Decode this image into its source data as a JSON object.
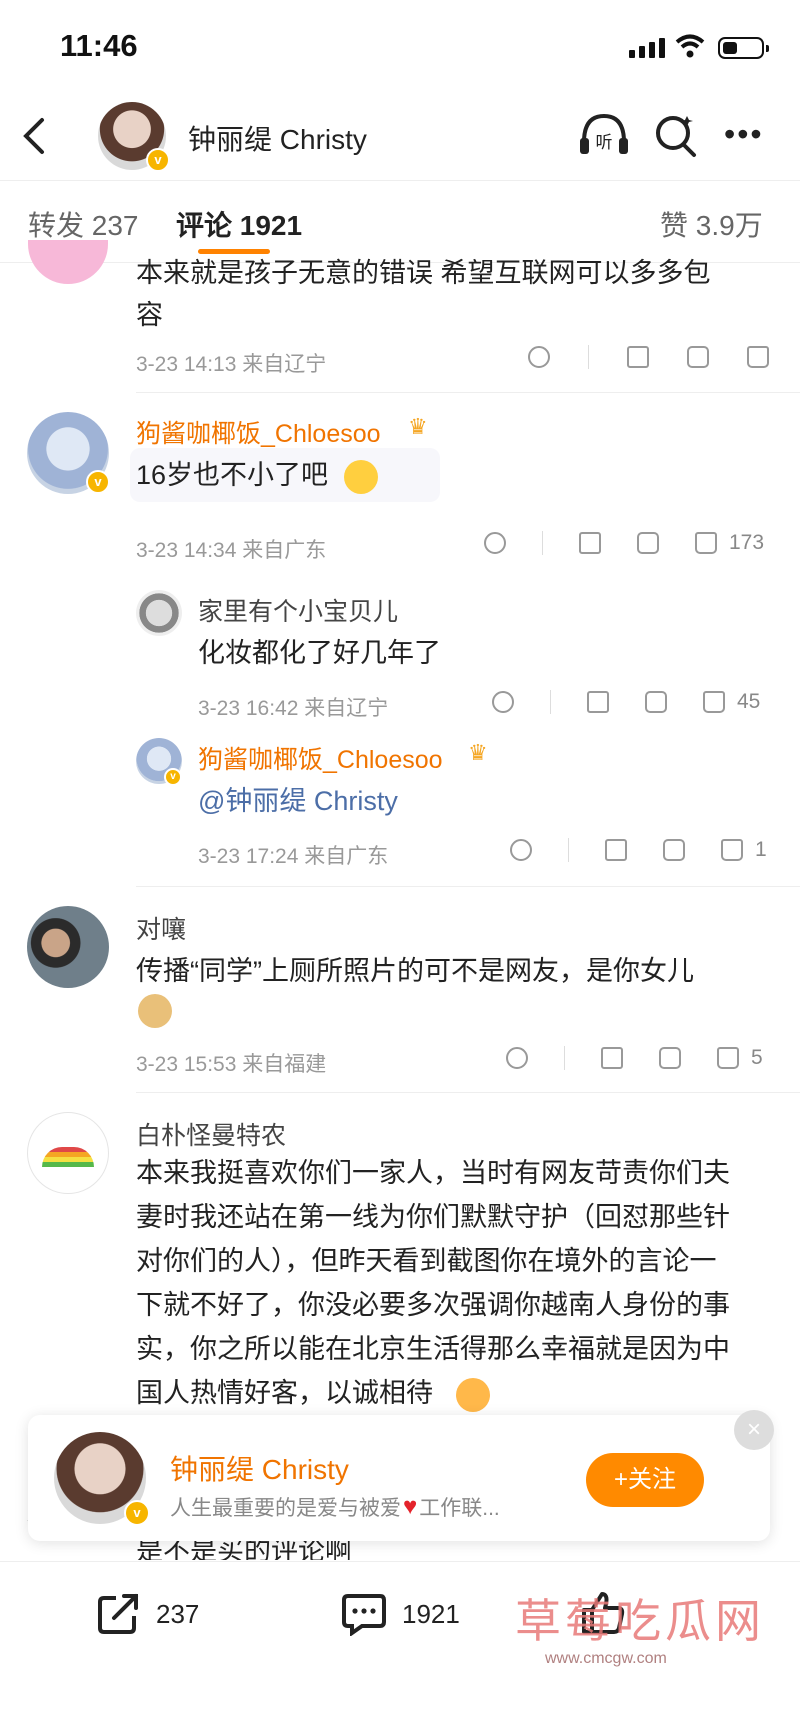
{
  "status": {
    "time": "11:46"
  },
  "header": {
    "title": "钟丽缇 Christy"
  },
  "tabs": {
    "repost": "转发 237",
    "comment": "评论 1921",
    "like": "赞 3.9万"
  },
  "comments": [
    {
      "text": "本来就是孩子无意的错误 希望互联网可以多多包容",
      "line1": "本来就是孩子无意的错误 希望互联网可以多多包",
      "line2": "容",
      "meta": "3-23 14:13 来自辽宁"
    },
    {
      "name": "狗酱咖椰饭_Chloesoo",
      "text": "16岁也不小了吧",
      "meta": "3-23 14:34 来自广东",
      "likes": "173",
      "replies": [
        {
          "name": "家里有个小宝贝儿",
          "text": "化妆都化了好几年了",
          "meta": "3-23 16:42 来自辽宁",
          "likes": "45"
        },
        {
          "name": "狗酱咖椰饭_Chloesoo",
          "text": "@钟丽缇 Christy",
          "meta": "3-23 17:24 来自广东",
          "likes": "1"
        }
      ]
    },
    {
      "name": "对嚷",
      "text": "传播“同学”上厕所照片的可不是网友，是你女儿",
      "meta": "3-23 15:53 来自福建",
      "likes": "5"
    },
    {
      "name": "白朴怪曼特农",
      "lines": [
        "本来我挺喜欢你们一家人，当时有网友苛责你们夫",
        "妻时我还站在第一线为你们默默守护（回怼那些针",
        "对你们的人），但昨天看到截图你在境外的言论一",
        "下就不好了，你没必要多次强调你越南人身份的事",
        "实，你之所以能在北京生活得那么幸福就是因为中",
        "国人热情好客，以诚相待"
      ]
    },
    {
      "partial_text": "是不是买的评论啊"
    }
  ],
  "follow_card": {
    "name": "钟丽缇 Christy",
    "bio": "人生最重要的是爱与被爱",
    "bio_tail": "工作联...",
    "button": "+关注",
    "close": "×"
  },
  "bottom_bar": {
    "repost_count": "237",
    "comment_count": "1921"
  },
  "watermark": {
    "text": "草莓吃瓜网",
    "url": "www.cmcgw.com"
  }
}
